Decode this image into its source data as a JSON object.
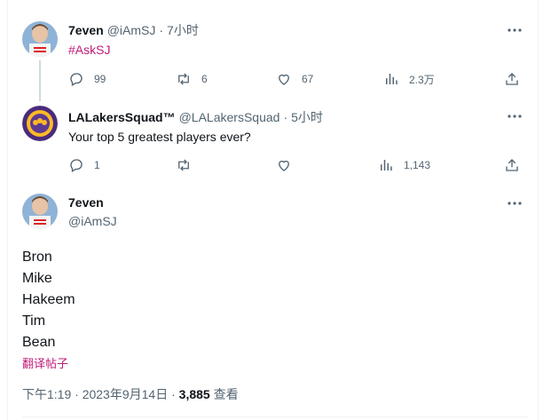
{
  "tweet1": {
    "name": "7even",
    "handle": "@iAmSJ",
    "sep": "·",
    "time": "7小时",
    "text": "#AskSJ",
    "replies": "99",
    "retweets": "6",
    "likes": "67",
    "views": "2.3万"
  },
  "tweet2": {
    "name": "LALakersSquad™",
    "handle": "@LALakersSquad",
    "sep": "·",
    "time": "5小时",
    "text": "Your top 5 greatest players ever?",
    "replies": "1",
    "retweets": "",
    "likes": "",
    "views": "1,143"
  },
  "main": {
    "name": "7even",
    "handle": "@iAmSJ",
    "lines": [
      "Bron",
      "Mike",
      "Hakeem",
      "Tim",
      "Bean"
    ],
    "translate": "翻译帖子",
    "time": "下午1:19",
    "sep": "·",
    "date": "2023年9月14日",
    "views_count": "3,885",
    "views_label": "查看"
  },
  "colors": {
    "accent": "#c01b79",
    "muted": "#536471",
    "text": "#0f1419"
  }
}
